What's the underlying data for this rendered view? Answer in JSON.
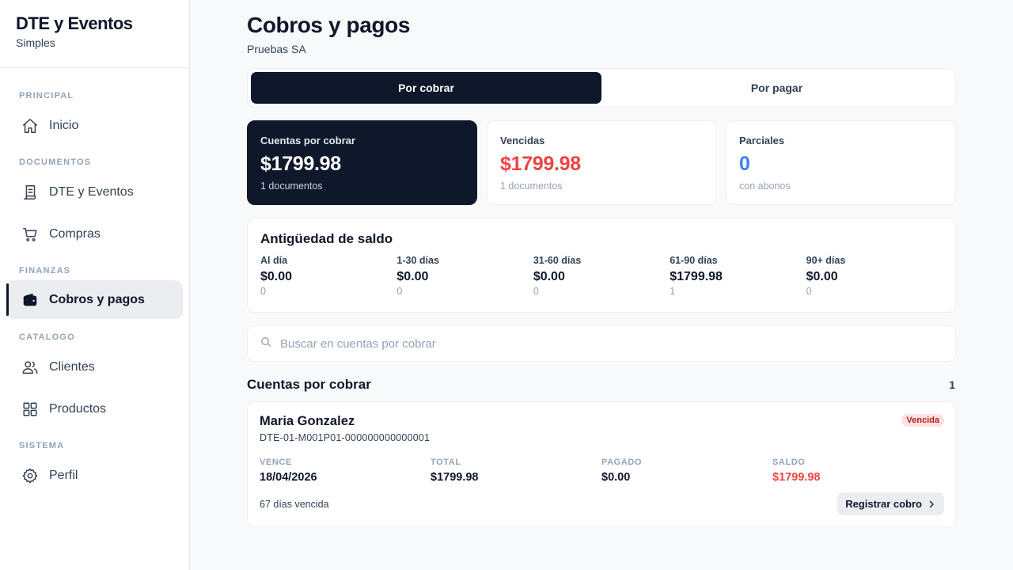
{
  "brand": {
    "title": "DTE y Eventos",
    "subtitle": "Simples"
  },
  "sidebar": {
    "sections": [
      "PRINCIPAL",
      "DOCUMENTOS",
      "FINANZAS",
      "CATALOGO",
      "SISTEMA"
    ],
    "items": [
      {
        "label": "Inicio",
        "icon": "home-icon"
      },
      {
        "label": "DTE y Eventos",
        "icon": "document-icon"
      },
      {
        "label": "Compras",
        "icon": "cart-icon"
      },
      {
        "label": "Cobros y pagos",
        "icon": "wallet-icon",
        "active": true
      },
      {
        "label": "Clientes",
        "icon": "users-icon"
      },
      {
        "label": "Productos",
        "icon": "grid-icon"
      },
      {
        "label": "Perfil",
        "icon": "gear-icon"
      }
    ]
  },
  "header": {
    "title": "Cobros y pagos",
    "company": "Pruebas SA"
  },
  "tabs": [
    {
      "label": "Por cobrar",
      "active": true
    },
    {
      "label": "Por pagar",
      "active": false
    }
  ],
  "stats": [
    {
      "label": "Cuentas por cobrar",
      "value": "$1799.98",
      "note": "1 documentos",
      "color": "#ffffff"
    },
    {
      "label": "Vencidas",
      "value": "$1799.98",
      "note": "1 documentos",
      "color": "#ef4444"
    },
    {
      "label": "Parciales",
      "value": "0",
      "note": "con abonos",
      "color": "#3b82f6"
    }
  ],
  "aging": {
    "title": "Antigüedad de saldo",
    "buckets": [
      {
        "label": "Al día",
        "amount": "$0.00",
        "count": "0"
      },
      {
        "label": "1-30 días",
        "amount": "$0.00",
        "count": "0"
      },
      {
        "label": "31-60 días",
        "amount": "$0.00",
        "count": "0"
      },
      {
        "label": "61-90 días",
        "amount": "$1799.98",
        "count": "1"
      },
      {
        "label": "90+ días",
        "amount": "$0.00",
        "count": "0"
      }
    ]
  },
  "search": {
    "placeholder": "Buscar en cuentas por cobrar",
    "value": ""
  },
  "list": {
    "title": "Cuentas por cobrar",
    "count": "1",
    "items": [
      {
        "name": "Maria Gonzalez",
        "doc": "DTE-01-M001P01-000000000000001",
        "status": "Vencida",
        "fields": [
          {
            "label": "VENCE",
            "value": "18/04/2026"
          },
          {
            "label": "TOTAL",
            "value": "$1799.98"
          },
          {
            "label": "PAGADO",
            "value": "$0.00"
          },
          {
            "label": "SALDO",
            "value": "$1799.98"
          }
        ],
        "overdue": "67 días vencida",
        "action": "Registrar cobro"
      }
    ]
  },
  "colors": {
    "dark": "#0f172a",
    "danger": "#ef4444",
    "info": "#3b82f6"
  }
}
